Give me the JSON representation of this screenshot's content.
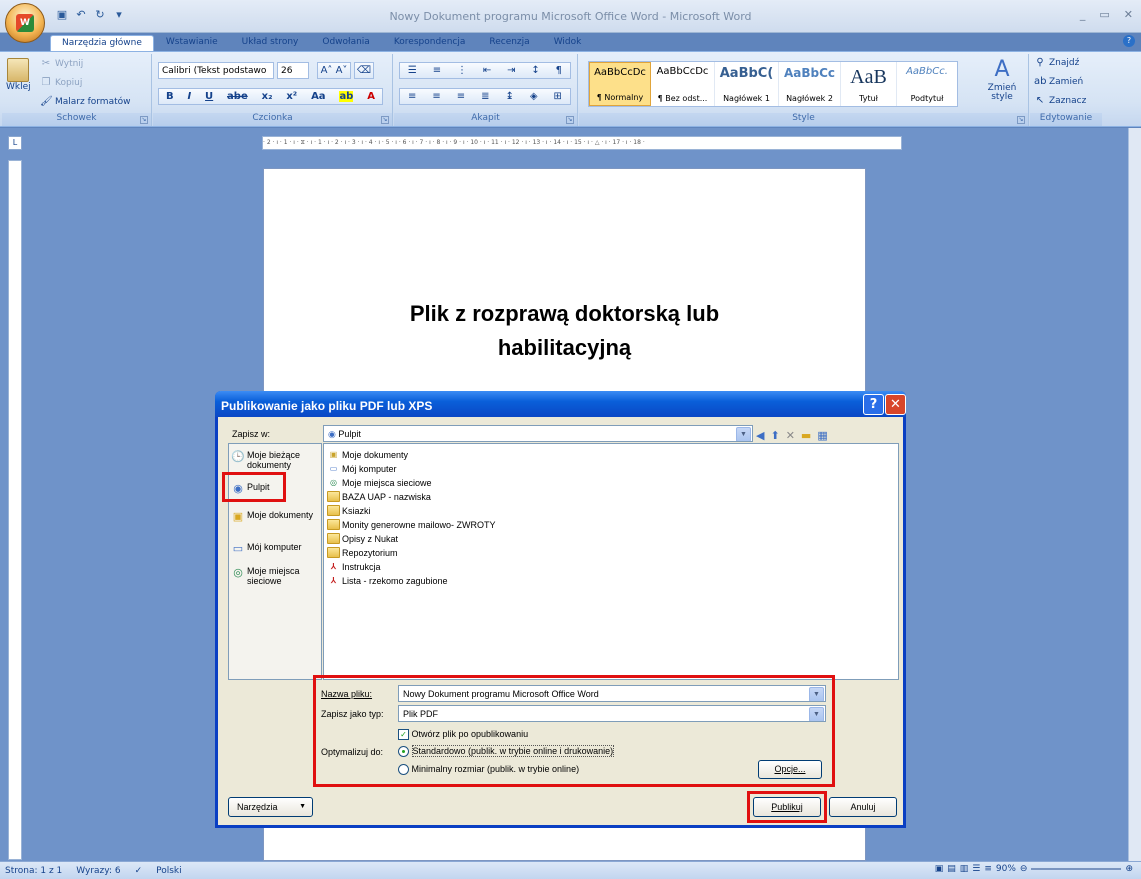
{
  "window": {
    "title": "Nowy Dokument programu Microsoft Office Word - Microsoft Word"
  },
  "tabs": [
    "Narzędzia główne",
    "Wstawianie",
    "Układ strony",
    "Odwołania",
    "Korespondencja",
    "Recenzja",
    "Widok"
  ],
  "ribbon": {
    "clipboard": {
      "paste": "Wklej",
      "cut": "Wytnij",
      "copy": "Kopiuj",
      "format_painter": "Malarz formatów",
      "group": "Schowek"
    },
    "font": {
      "name": "Calibri (Tekst podstawo",
      "size": "26",
      "group": "Czcionka"
    },
    "paragraph": {
      "group": "Akapit"
    },
    "styles": {
      "items": [
        {
          "preview": "AaBbCcDc",
          "name": "¶ Normalny"
        },
        {
          "preview": "AaBbCcDc",
          "name": "¶ Bez odst..."
        },
        {
          "preview": "AaBbC(",
          "name": "Nagłówek 1"
        },
        {
          "preview": "AaBbCc",
          "name": "Nagłówek 2"
        },
        {
          "preview": "AaB",
          "name": "Tytuł"
        },
        {
          "preview": "AaBbCc.",
          "name": "Podtytuł"
        }
      ],
      "change": "Zmień style",
      "group": "Style"
    },
    "editing": {
      "find": "Znajdź",
      "replace": "Zamień",
      "select": "Zaznacz",
      "group": "Edytowanie"
    }
  },
  "document": {
    "line1": "Plik z rozprawą doktorską lub",
    "line2": "habilitacyjną"
  },
  "ruler": {
    "ticks": "· 2 · ı · 1 · ı · ⧖ · ı · 1 · ı · 2 · ı · 3 · ı · 4 · ı · 5 · ı · 6 · ı · 7 · ı · 8 · ı · 9 · ı · 10 · ı · 11 · ı · 12 · ı · 13 · ı · 14 · ı · 15 · ı · △ · ı · 17 · ı · 18 ·"
  },
  "dialog": {
    "title": "Publikowanie jako pliku PDF lub XPS",
    "save_in_label": "Zapisz w:",
    "save_in_value": "Pulpit",
    "places": [
      "Moje bieżące dokumenty",
      "Pulpit",
      "Moje dokumenty",
      "Mój komputer",
      "Moje miejsca sieciowe"
    ],
    "files": [
      {
        "name": "Moje dokumenty",
        "icon": "documents-icon"
      },
      {
        "name": "Mój komputer",
        "icon": "computer-icon"
      },
      {
        "name": "Moje miejsca sieciowe",
        "icon": "network-icon"
      },
      {
        "name": "BAZA UAP - nazwiska",
        "icon": "folder-icon"
      },
      {
        "name": "Ksiazki",
        "icon": "folder-icon"
      },
      {
        "name": "Monity generowne mailowo- ZWROTY",
        "icon": "folder-icon"
      },
      {
        "name": "Opisy z Nukat",
        "icon": "folder-icon"
      },
      {
        "name": "Repozytorium",
        "icon": "folder-icon"
      },
      {
        "name": "Instrukcja",
        "icon": "pdf-icon"
      },
      {
        "name": "Lista - rzekomo zagubione",
        "icon": "pdf-icon"
      }
    ],
    "filename_label": "Nazwa pliku:",
    "filename_value": "Nowy Dokument programu Microsoft Office Word",
    "filetype_label": "Zapisz jako typ:",
    "filetype_value": "Plik PDF",
    "open_after": "Otwórz plik po opublikowaniu",
    "optimize_label": "Optymalizuj do:",
    "opt_standard": "Standardowo (publik. w trybie online i drukowanie)",
    "opt_minimal": "Minimalny rozmiar (publik. w trybie online)",
    "options_btn": "Opcje...",
    "tools_btn": "Narzędzia",
    "publish_btn": "Publikuj",
    "cancel_btn": "Anuluj"
  },
  "status": {
    "page": "Strona: 1 z 1",
    "words": "Wyrazy: 6",
    "lang": "Polski",
    "zoom": "90%"
  },
  "colors": {
    "highlight": "#e01010",
    "dialog_title": "#0a47c5",
    "ribbon": "#d5e3f4"
  }
}
